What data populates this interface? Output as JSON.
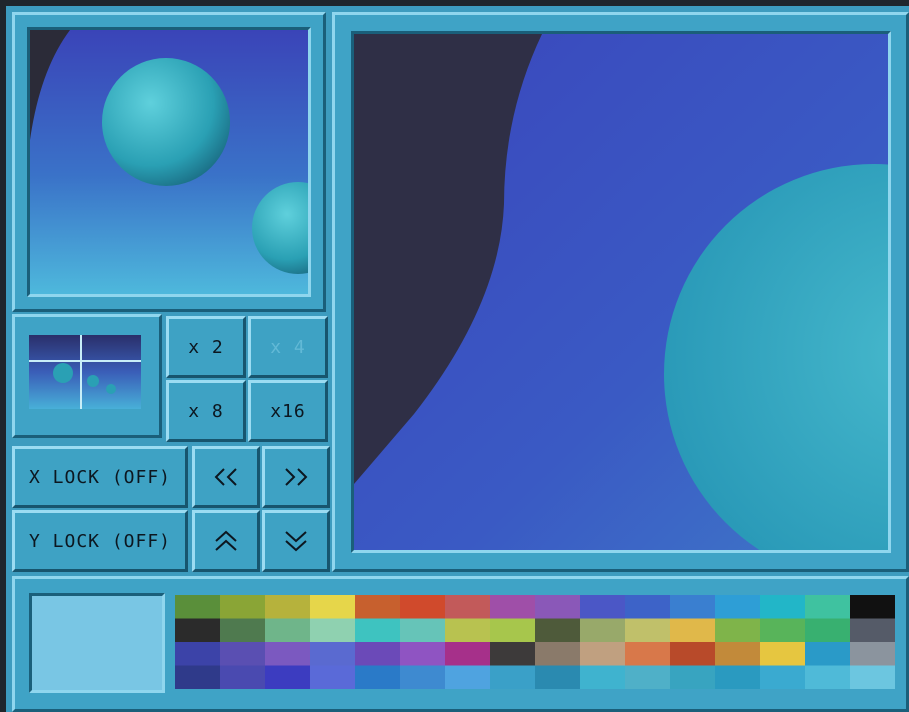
{
  "zoom_buttons": {
    "x2": "x 2",
    "x4": "x 4",
    "x8": "x 8",
    "x16": "x16"
  },
  "lock_buttons": {
    "x_lock": "X LOCK (OFF)",
    "y_lock": "Y LOCK (OFF)"
  },
  "scroll_icons": {
    "left": "double-chevron-left-icon",
    "right": "double-chevron-right-icon",
    "up": "double-chevron-up-icon",
    "down": "double-chevron-down-icon"
  },
  "colors": {
    "frame": "#3d9cbf",
    "bevel_light": "#8fd6ee",
    "bevel_dark": "#1a5f7a",
    "selected_color": "#79c6e4"
  },
  "palette": {
    "rows": [
      [
        "#5a8f3a",
        "#8aa536",
        "#b6b23c",
        "#e6d64a",
        "#c7602e",
        "#d04a2c",
        "#c25a5a",
        "#9f4fa8",
        "#8a58b8",
        "#4b57c6",
        "#3d63c8",
        "#3a7fd0",
        "#2e9ed6",
        "#22b6c8",
        "#3fc2a0",
        "#111111"
      ],
      [
        "#2b2b2b",
        "#4f7a4f",
        "#6fb58a",
        "#8fd1b0",
        "#3ec3c0",
        "#66c4b8",
        "#b8c250",
        "#a7c64c",
        "#4e5a3a",
        "#98a96a",
        "#c0c06a",
        "#e0b84a",
        "#7fb44a",
        "#58b45a",
        "#38b070",
        "#555b68"
      ],
      [
        "#3c43a8",
        "#5a4fb2",
        "#7b59c0",
        "#5a6ad0",
        "#6b4ab8",
        "#8f54c2",
        "#a6308a",
        "#3d3a3a",
        "#8a7a6a",
        "#c0a080",
        "#d8784a",
        "#b84a2a",
        "#c28a3a",
        "#e6c640",
        "#2a9ac8",
        "#8b949e"
      ],
      [
        "#2f3a8a",
        "#4a4ab0",
        "#3c3cc0",
        "#5a6ad8",
        "#2a7ac8",
        "#3e8ad0",
        "#4fa3e0",
        "#3aa0c8",
        "#2a8ab0",
        "#3fb3cf",
        "#4fb0c8",
        "#38a4c0",
        "#2a9ac0",
        "#3aaad0",
        "#4fbad8",
        "#6cc6e0"
      ]
    ]
  }
}
